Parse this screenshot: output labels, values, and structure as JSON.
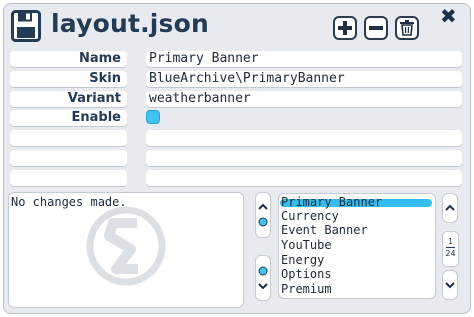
{
  "window": {
    "title": "layout.json"
  },
  "toolbar": {
    "add_icon": "plus-icon",
    "remove_icon": "minus-icon",
    "delete_icon": "trash-icon",
    "close_label": "✖"
  },
  "fields": {
    "name": {
      "label": "Name",
      "value": "Primary Banner"
    },
    "skin": {
      "label": "Skin",
      "value": "BlueArchive\\PrimaryBanner"
    },
    "variant": {
      "label": "Variant",
      "value": "weatherbanner"
    },
    "enable": {
      "label": "Enable",
      "checked": true
    }
  },
  "status": {
    "text": "No changes made."
  },
  "list": {
    "items": [
      "Primary Banner",
      "Currency",
      "Event Banner",
      "YouTube",
      "Energy",
      "Options",
      "Premium"
    ],
    "selected_index": 0
  },
  "pager": {
    "current": "1",
    "total": "24"
  },
  "colors": {
    "accent": "#35bdf0",
    "dark": "#243b55",
    "panel": "#e7eaee"
  }
}
